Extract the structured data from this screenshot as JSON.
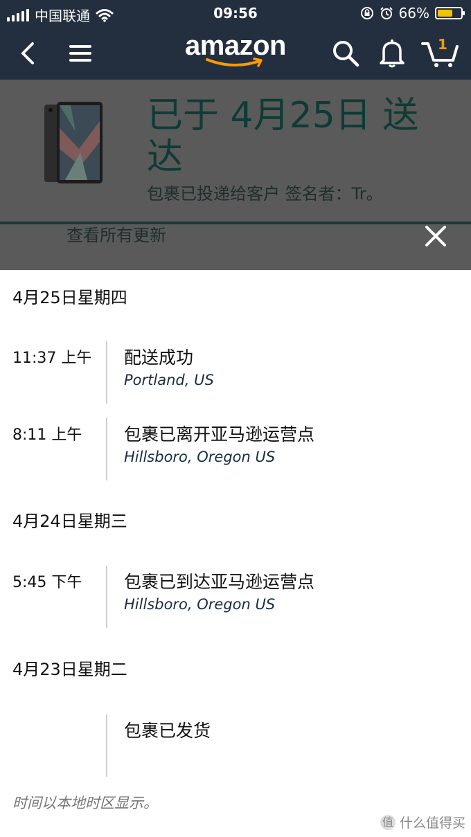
{
  "status_bar": {
    "carrier": "中国联通",
    "time": "09:56",
    "battery_percent": "66%",
    "battery_level": 0.66
  },
  "nav": {
    "logo_text": "amazon",
    "cart_count": "1",
    "colors": {
      "bar": "#232f3e",
      "accent": "#ff9900"
    }
  },
  "delivery": {
    "status_title": "已于 4月25日 送达",
    "status_detail": "包裹已投递给客户 签名者：Tr。",
    "view_all_label": "查看所有更新"
  },
  "timeline": [
    {
      "date": "4月25日星期四",
      "events": [
        {
          "time": "11:37 上午",
          "description": "配送成功",
          "location": "Portland, US"
        },
        {
          "time": "8:11 上午",
          "description": "包裹已离开亚马逊运营点",
          "location": "Hillsboro, Oregon US"
        }
      ]
    },
    {
      "date": "4月24日星期三",
      "events": [
        {
          "time": "5:45 下午",
          "description": "包裹已到达亚马逊运营点",
          "location": "Hillsboro, Oregon US"
        }
      ]
    },
    {
      "date": "4月23日星期二",
      "events": [
        {
          "time": "",
          "description": "包裹已发货",
          "location": ""
        }
      ]
    }
  ],
  "footnote": "时间以本地时区显示。",
  "watermark": "什么值得买",
  "icons": [
    "signal-icon",
    "wifi-icon",
    "lock-rotation-icon",
    "alarm-icon",
    "battery-icon",
    "back-chevron-icon",
    "hamburger-menu-icon",
    "search-icon",
    "bell-icon",
    "cart-icon",
    "close-icon"
  ]
}
